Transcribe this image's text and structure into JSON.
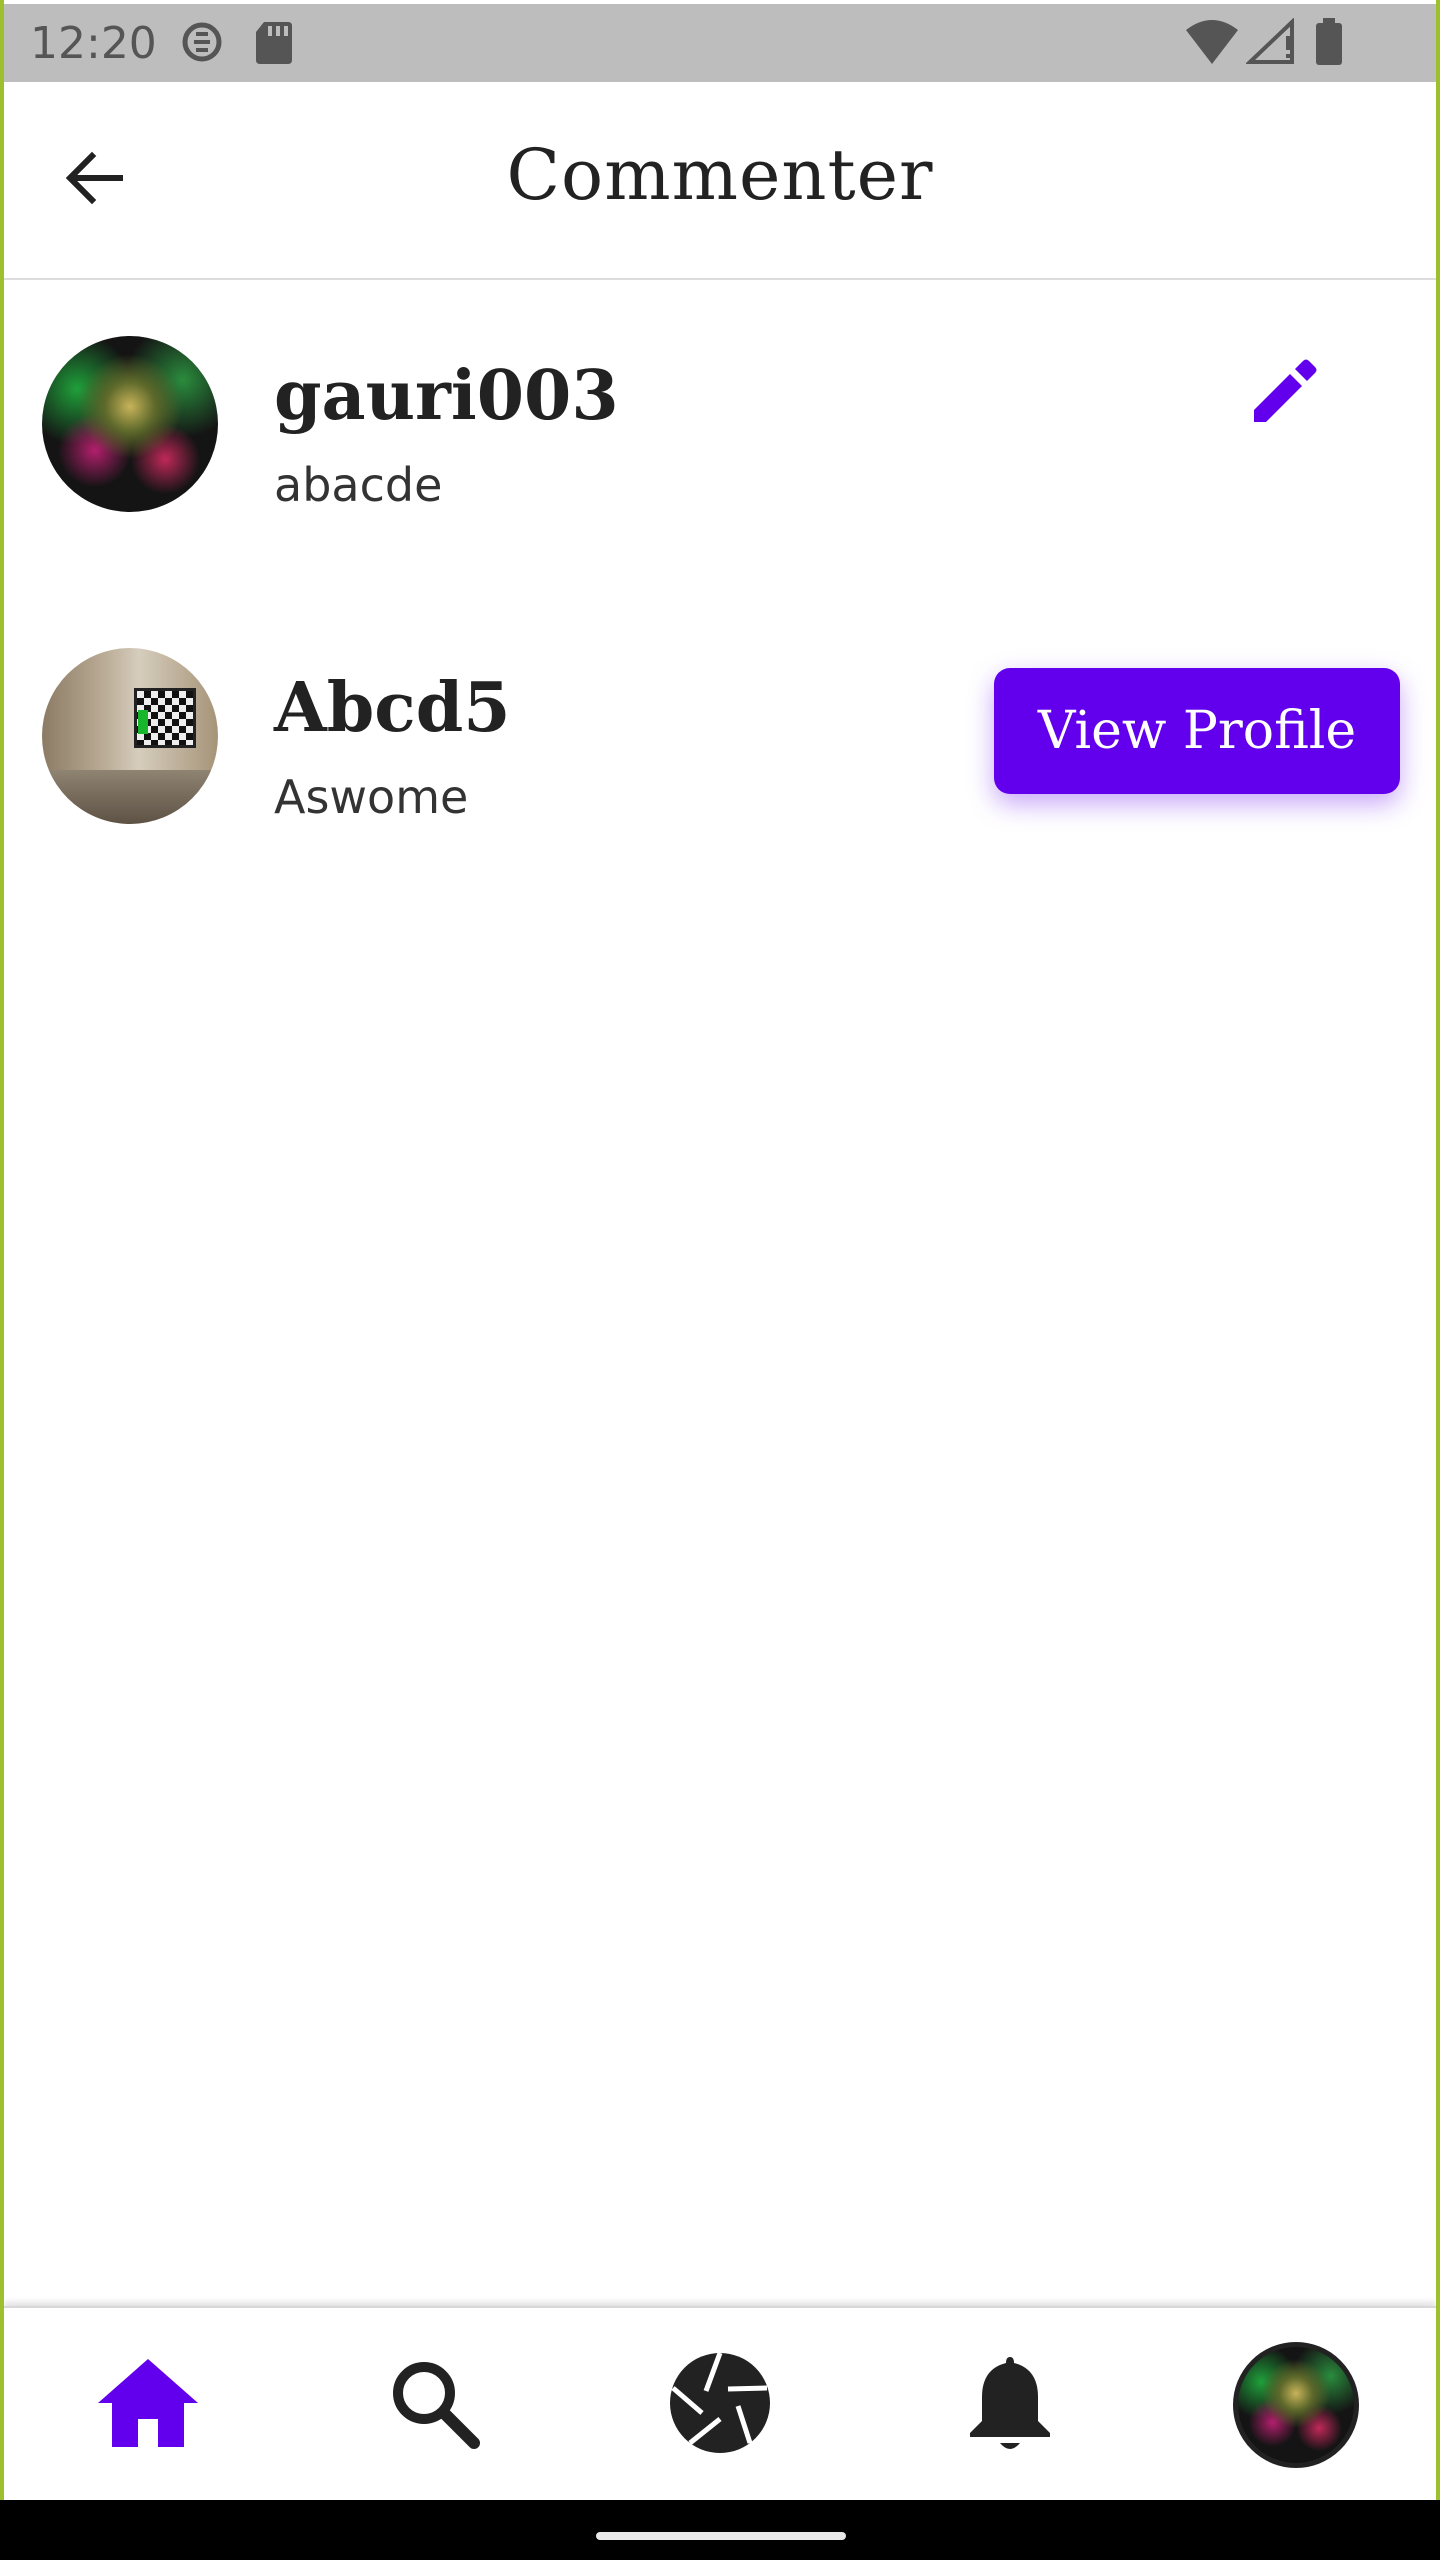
{
  "status_bar": {
    "time": "12:20",
    "left_icons": [
      "circle-s-icon",
      "sd-card-icon"
    ],
    "right_icons": [
      "wifi-icon",
      "signal-icon",
      "battery-icon"
    ]
  },
  "app_bar": {
    "title": "Commenter",
    "back_icon": "arrow-back-icon"
  },
  "comments": [
    {
      "username": "gauri003",
      "text": "abacde",
      "avatar": "joker-portrait",
      "action_icon": "pencil-icon"
    },
    {
      "username": "Abcd5",
      "text": "Aswome",
      "avatar": "room-tv",
      "action_label": "View Profile"
    }
  ],
  "bottom_nav": {
    "items": [
      "home-icon",
      "search-icon",
      "camera-shutter-icon",
      "bell-icon",
      "profile-avatar"
    ],
    "active": "home-icon"
  },
  "colors": {
    "accent": "#6200ee",
    "status_bar": "#bdbdbd",
    "frame": "#9dc02f"
  }
}
